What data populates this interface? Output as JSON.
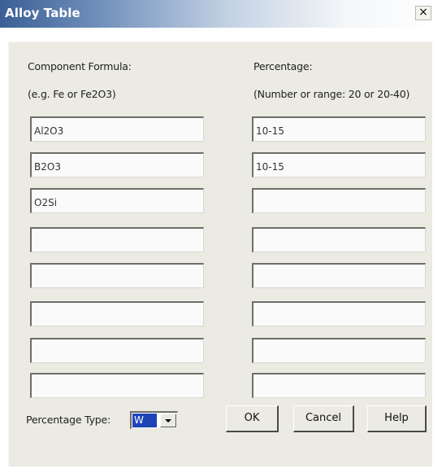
{
  "window": {
    "title": "Alloy Table",
    "close_glyph": "×"
  },
  "labels": {
    "formula_header": "Component Formula:",
    "formula_hint": "(e.g. Fe or Fe2O3)",
    "percentage_header": "Percentage:",
    "percentage_hint": "(Number or range: 20 or 20-40)"
  },
  "rows": [
    {
      "formula": "Al2O3",
      "percentage": "10-15"
    },
    {
      "formula": "B2O3",
      "percentage": "10-15"
    },
    {
      "formula": "O2Si",
      "percentage": ""
    },
    {
      "formula": "",
      "percentage": ""
    },
    {
      "formula": "",
      "percentage": ""
    },
    {
      "formula": "",
      "percentage": ""
    },
    {
      "formula": "",
      "percentage": ""
    },
    {
      "formula": "",
      "percentage": ""
    }
  ],
  "footer": {
    "percentage_type_label": "Percentage Type:",
    "percentage_type_value": "W",
    "ok_label": "OK",
    "cancel_label": "Cancel",
    "help_label": "Help"
  },
  "colors": {
    "title_gradient_start": "#3b5f95",
    "dialog_background": "#ebeae3",
    "selection": "#1e45b8"
  },
  "icons": {
    "close": "close-icon",
    "dropdown": "chevron-down-icon"
  }
}
